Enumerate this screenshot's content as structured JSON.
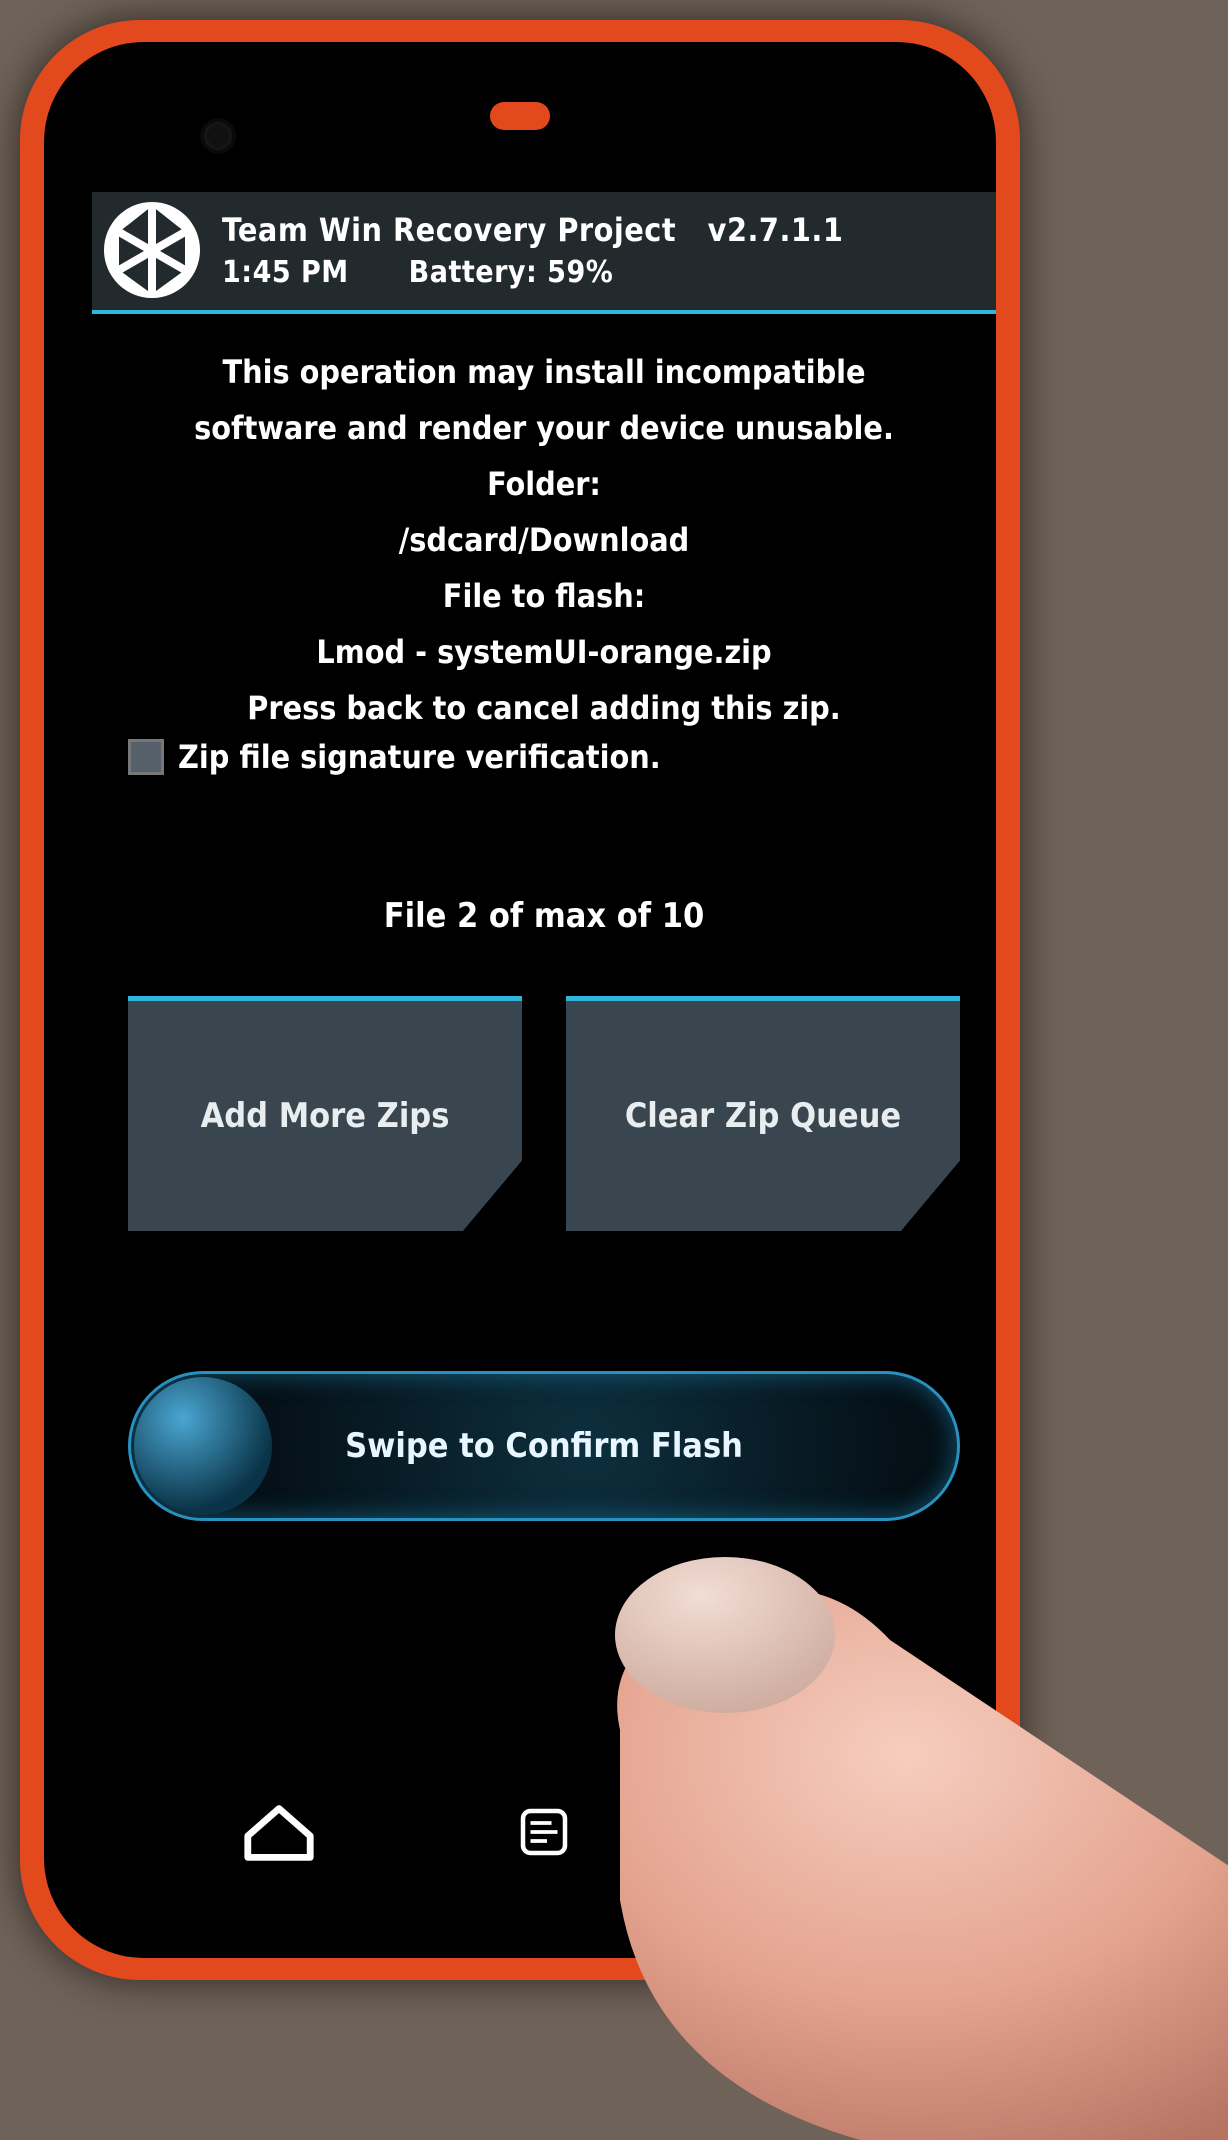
{
  "header": {
    "title": "Team Win Recovery Project",
    "version": "v2.7.1.1",
    "time": "1:45 PM",
    "battery_label": "Battery:",
    "battery_value": "59%"
  },
  "info": {
    "warning1": "This operation may install incompatible",
    "warning2": "software and render your device unusable.",
    "folder_label": "Folder:",
    "folder_path": "/sdcard/Download",
    "file_label": "File to flash:",
    "file_name": "Lmod - systemUI-orange.zip",
    "cancel_hint": "Press back to cancel adding this zip."
  },
  "checkbox": {
    "label": "Zip file signature verification."
  },
  "queue": {
    "count_text": "File 2 of max of 10"
  },
  "buttons": {
    "add_more": "Add More Zips",
    "clear_queue": "Clear Zip Queue"
  },
  "swipe": {
    "label": "Swipe to Confirm Flash"
  }
}
